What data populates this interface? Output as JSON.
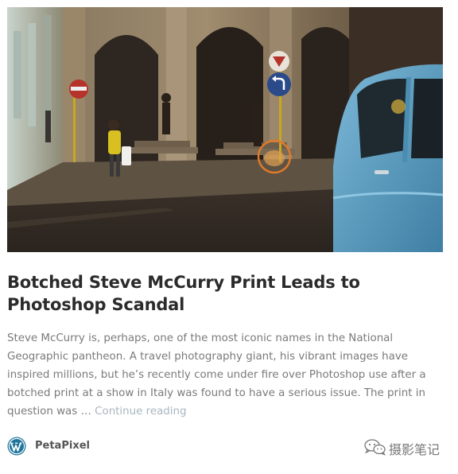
{
  "article": {
    "title": "Botched Steve McCurry Print Leads to Photoshop Scandal",
    "excerpt": "Steve McCurry is, perhaps, one of the most iconic names in the National Geographic pantheon. A travel photography giant, his vibrant images have inspired millions, but he’s recently come under fire over Photoshop use after a botched print at a show in Italy was found to have a serious issue. The print in question was …",
    "continue_label": "Continue reading"
  },
  "footer": {
    "source_icon": "wordpress-icon",
    "source_name": "PetaPixel",
    "watermark_icon": "wechat-icon",
    "watermark_text": "摄影笔记"
  },
  "colors": {
    "title": "#2b2b2b",
    "excerpt": "#7a7a7a",
    "link": "#a8b6c0",
    "car": "#5a9ec4"
  }
}
